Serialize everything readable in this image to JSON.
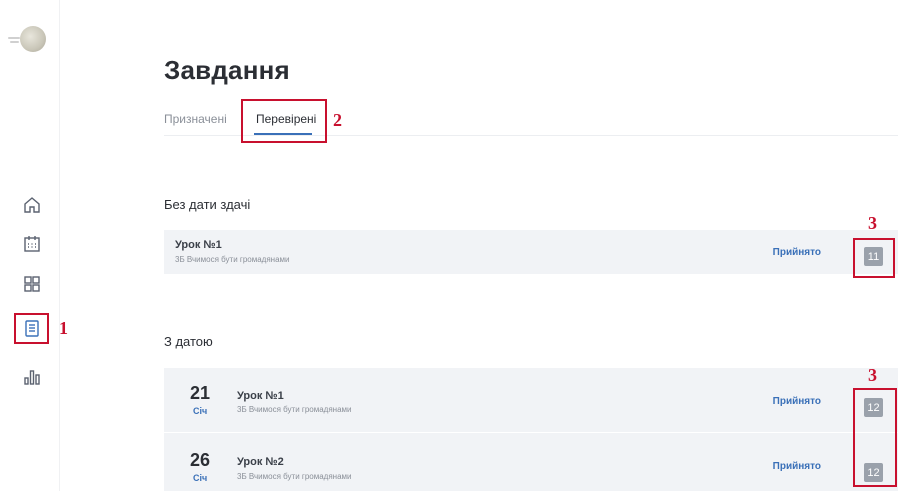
{
  "page": {
    "title": "Завдання"
  },
  "tabs": [
    {
      "label": "Призначені"
    },
    {
      "label": "Перевірені"
    }
  ],
  "sidebar": {
    "icons": [
      "home-icon",
      "calendar-icon",
      "grid-icon",
      "tasks-icon",
      "stats-icon"
    ]
  },
  "markers": {
    "nav": "1",
    "tab": "2",
    "grades_top": "3",
    "grades_bottom": "3"
  },
  "sections": {
    "no_date": {
      "title": "Без дати здачі",
      "items": [
        {
          "title": "Урок №1",
          "subtitle": "3Б Вчимося бути громадянами",
          "status": "Прийнято",
          "grade": "11"
        }
      ]
    },
    "with_date": {
      "title": "З датою",
      "items": [
        {
          "day": "21",
          "month": "Січ",
          "title": "Урок №1",
          "subtitle": "3Б Вчимося бути громадянами",
          "status": "Прийнято",
          "grade": "12"
        },
        {
          "day": "26",
          "month": "Січ",
          "title": "Урок №2",
          "subtitle": "3Б Вчимося бути громадянами",
          "status": "Прийнято",
          "grade": "12"
        }
      ]
    }
  },
  "colors": {
    "accent": "#3a70b8",
    "highlight": "#c8102e",
    "row_bg": "#f1f3f6",
    "grade_bg": "#9aa1ab"
  }
}
